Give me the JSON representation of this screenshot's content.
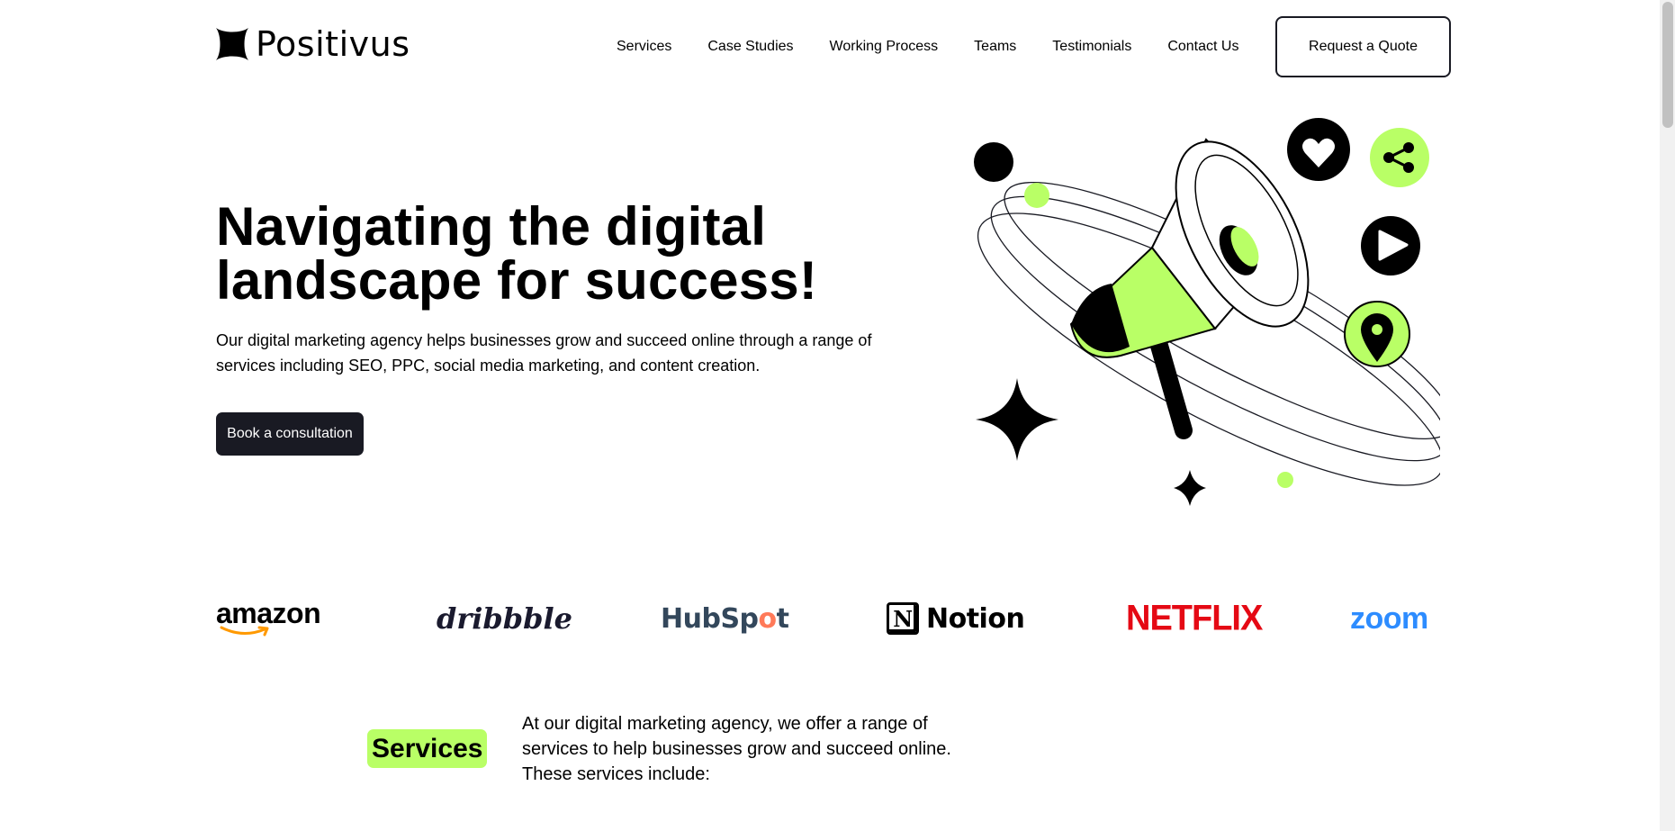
{
  "header": {
    "logo_text": "Positivus",
    "nav": [
      {
        "label": "Services"
      },
      {
        "label": "Case Studies"
      },
      {
        "label": "Working Process"
      },
      {
        "label": "Teams"
      },
      {
        "label": "Testimonials"
      },
      {
        "label": "Contact Us"
      }
    ],
    "cta_label": "Request a Quote"
  },
  "hero": {
    "title_line1": "Navigating the digital",
    "title_line2": "landscape for success!",
    "description": "Our digital marketing agency helps businesses grow and succeed online through a range of services including SEO, PPC, social media marketing, and content creation.",
    "cta_label": "Book a consultation",
    "illustration_icons": [
      "megaphone-icon",
      "heart-icon",
      "share-icon",
      "play-icon",
      "location-pin-icon",
      "sparkle-icon"
    ]
  },
  "logos": {
    "amazon": "amazon",
    "dribbble": "dribbble",
    "hubspot_part1": "HubSp",
    "hubspot_o": "o",
    "hubspot_part2": "t",
    "notion_mark": "N",
    "notion": "Notion",
    "netflix": "NETFLIX",
    "zoom": "zoom"
  },
  "services": {
    "tag": "Services",
    "description": "At our digital marketing agency, we offer a range of services to help businesses grow and succeed online. These services include:"
  },
  "colors": {
    "accent_green": "#B9FF66",
    "dark": "#191A23",
    "netflix_red": "#E50914",
    "zoom_blue": "#2D8CFF",
    "hubspot_navy": "#33475b",
    "hubspot_orange": "#ff7a59",
    "amazon_orange": "#FF9900"
  }
}
